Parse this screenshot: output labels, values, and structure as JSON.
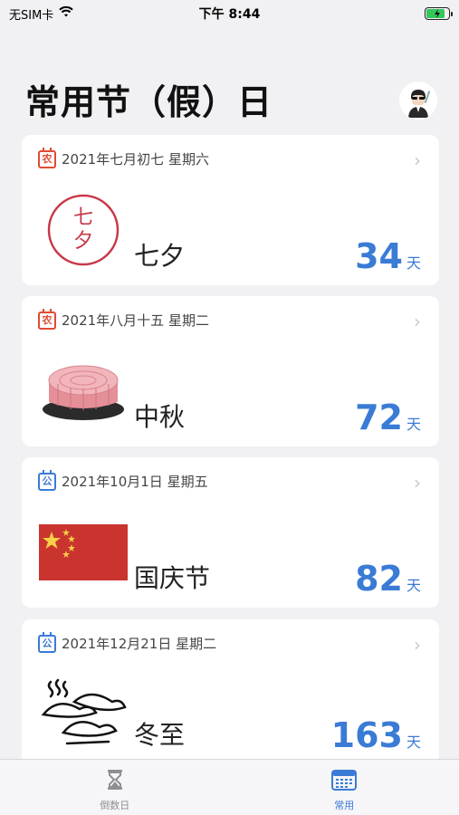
{
  "status_bar": {
    "carrier": "无SIM卡",
    "time": "下午 8:44"
  },
  "header": {
    "title": "常用节（假）日",
    "avatar_icon": "avatar-icon"
  },
  "colors": {
    "accent": "#3a7bd5",
    "lunar_badge": "#e24a34",
    "battery": "#34c759"
  },
  "cards": [
    {
      "badge": "农",
      "date": "2021年七月初七 星期六",
      "name": "七夕",
      "days": "34",
      "unit": "天",
      "image": "qixi-stamp-icon"
    },
    {
      "badge": "农",
      "date": "2021年八月十五 星期二",
      "name": "中秋",
      "days": "72",
      "unit": "天",
      "image": "mooncake-icon"
    },
    {
      "badge": "公",
      "date": "2021年10月1日 星期五",
      "name": "国庆节",
      "days": "82",
      "unit": "天",
      "image": "china-flag-icon"
    },
    {
      "badge": "公",
      "date": "2021年12月21日 星期二",
      "name": "冬至",
      "days": "163",
      "unit": "天",
      "image": "dumplings-icon"
    }
  ],
  "qixi_stamp_text": [
    "七",
    "夕"
  ],
  "tabs": [
    {
      "label": "倒数日",
      "icon": "hourglass-icon",
      "active": false
    },
    {
      "label": "常用",
      "icon": "calendar-icon",
      "active": true
    }
  ]
}
